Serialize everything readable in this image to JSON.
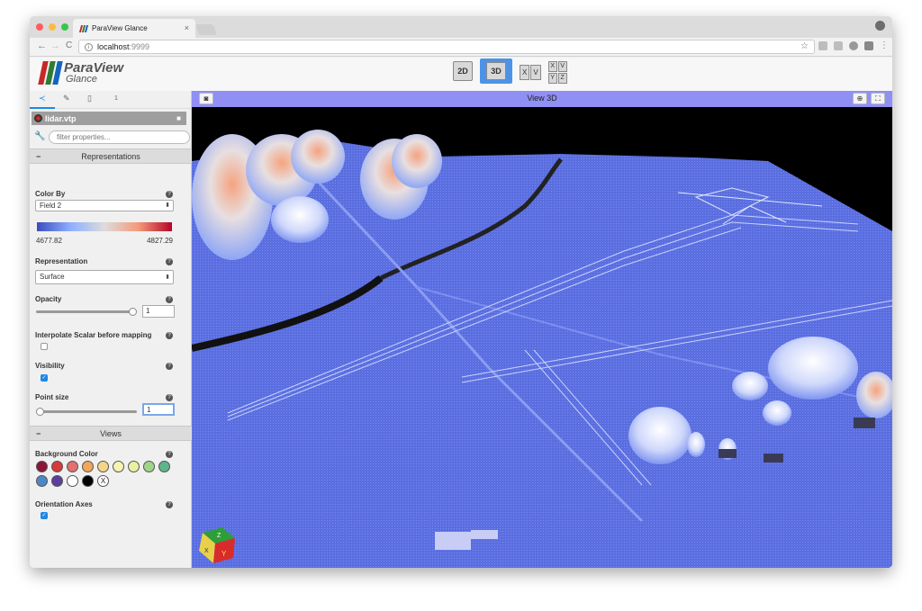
{
  "browser": {
    "tab_title": "ParaView Glance",
    "tab_close": "×",
    "url_host": "localhost",
    "url_port": ":9999",
    "back_icon": "←",
    "forward_icon": "→",
    "reload_icon": "C",
    "star_icon": "☆"
  },
  "app": {
    "logo_title": "ParaView",
    "logo_subtitle": "Glance",
    "view_buttons": {
      "btn_2d": "2D",
      "btn_3d": "3D",
      "btn_x": "X",
      "btn_v": "V",
      "grid_x": "X",
      "grid_v": "V",
      "grid_y": "Y",
      "grid_z": "Z"
    }
  },
  "sidebar": {
    "tab_count": "1",
    "source_name": "lidar.vtp",
    "filter_placeholder": "filter properties...",
    "sections": {
      "representations": "Representations",
      "views": "Views"
    },
    "color_by": {
      "label": "Color By",
      "value": "Field 2"
    },
    "range": {
      "min": "4677.82",
      "max": "4827.29"
    },
    "representation": {
      "label": "Representation",
      "value": "Surface"
    },
    "opacity": {
      "label": "Opacity",
      "value": "1",
      "level": 1.0
    },
    "interpolate": {
      "label": "Interpolate Scalar before mapping",
      "checked": false
    },
    "visibility": {
      "label": "Visibility",
      "checked": true
    },
    "point_size": {
      "label": "Point size",
      "value": "1",
      "level": 0.0
    },
    "background": {
      "label": "Background Color",
      "colors": [
        "#8a1538",
        "#d63a3a",
        "#e36f6f",
        "#f2a65a",
        "#f5d58a",
        "#f7f3b0",
        "#e9f2a2",
        "#9fd489",
        "#5fb58a",
        "#4f86c6",
        "#5a3f9f",
        "#ffffff",
        "#000000"
      ],
      "none_label": "X"
    },
    "orientation_axes": {
      "label": "Orientation Axes",
      "checked": true
    }
  },
  "view": {
    "title": "View 3D",
    "camera_icon": "camera-icon",
    "globe_icon": "globe-icon",
    "fullscreen_icon": "fullscreen-icon",
    "axes_labels": {
      "z": "Z",
      "x": "X",
      "y": "Y"
    }
  }
}
